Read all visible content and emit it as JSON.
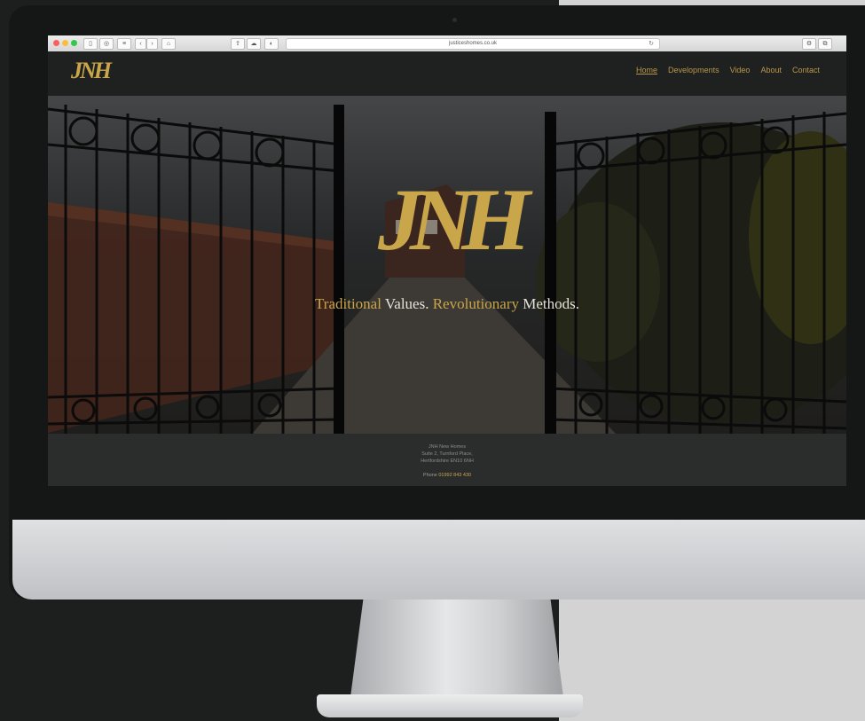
{
  "browser": {
    "url": "justiceshomes.co.uk"
  },
  "site": {
    "logo_text": "JNH",
    "nav": [
      {
        "label": "Home",
        "active": true
      },
      {
        "label": "Developments",
        "active": false
      },
      {
        "label": "Video",
        "active": false
      },
      {
        "label": "About",
        "active": false
      },
      {
        "label": "Contact",
        "active": false
      }
    ]
  },
  "hero": {
    "logo_text": "JNH",
    "tagline": {
      "w1": "Traditional",
      "w2": "Values.",
      "w3": "Revolutionary",
      "w4": "Methods."
    }
  },
  "footer": {
    "line1": "JNH New Homes",
    "line2": "Suite 2, Turnford Place,",
    "line3": "Hertfordshire EN10 6NH",
    "phone_label": "Phone",
    "phone_number": "01992 843 430"
  },
  "colors": {
    "gold": "#c9a64a",
    "dark": "#1f2121"
  }
}
